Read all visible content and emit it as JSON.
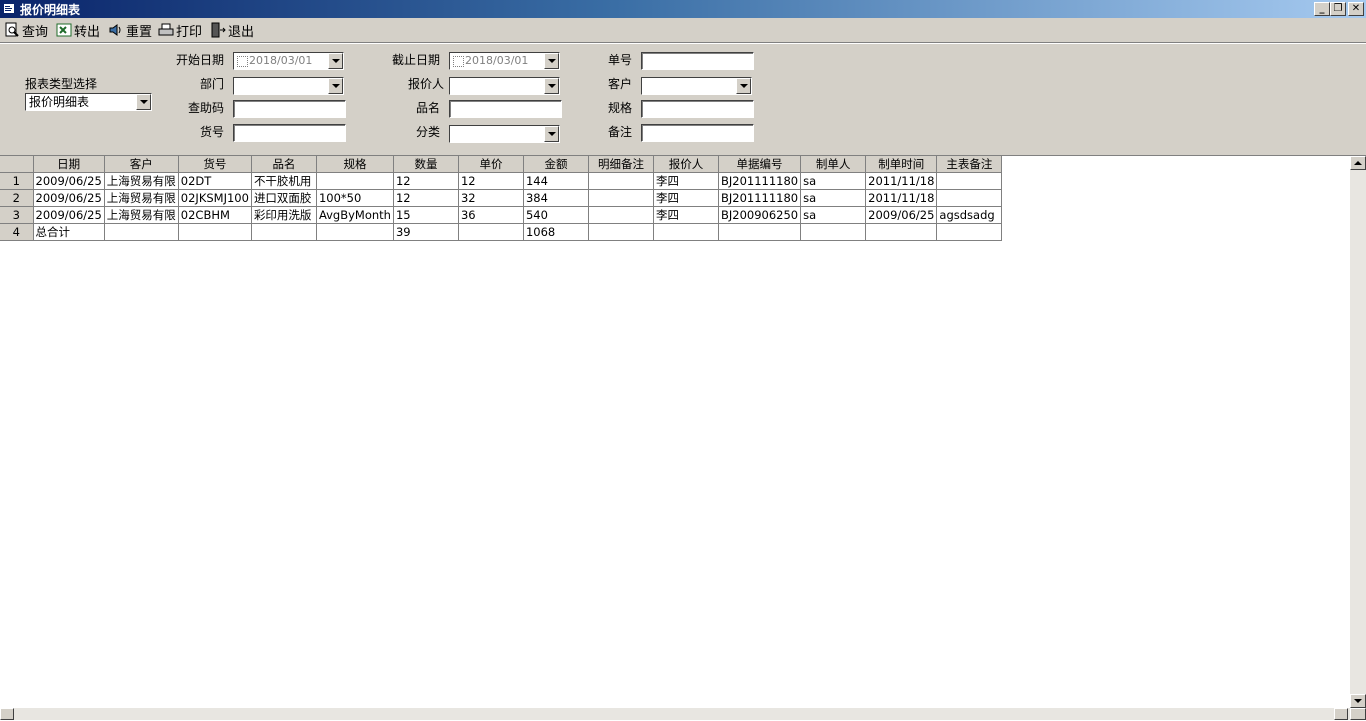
{
  "window": {
    "title": "报价明细表",
    "buttons": [
      "_",
      "❐",
      "✕"
    ]
  },
  "toolbar": {
    "query": "查询",
    "export": "转出",
    "reset": "重置",
    "print": "打印",
    "exit": "退出"
  },
  "filters": {
    "report_type_label": "报表类型选择",
    "report_type_value": "报价明细表",
    "start_date_label": "开始日期",
    "start_date_value": "2018/03/01",
    "end_date_label": "截止日期",
    "end_date_value": "2018/03/01",
    "doc_no_label": "单号",
    "dept_label": "部门",
    "quoter_label": "报价人",
    "customer_label": "客户",
    "helpcode_label": "查助码",
    "product_name_label": "品名",
    "spec_label": "规格",
    "item_no_label": "货号",
    "category_label": "分类",
    "remark_label": "备注"
  },
  "grid": {
    "columns": [
      "日期",
      "客户",
      "货号",
      "品名",
      "规格",
      "数量",
      "单价",
      "金额",
      "明细备注",
      "报价人",
      "单据编号",
      "制单人",
      "制单时间",
      "主表备注"
    ],
    "rows": [
      [
        "1",
        "2009/06/25",
        "上海贸易有限",
        "02DT",
        "不干胶机用",
        "",
        "12",
        "12",
        "144",
        "",
        "李四",
        "BJ201111180",
        "sa",
        "2011/11/18",
        ""
      ],
      [
        "2",
        "2009/06/25",
        "上海贸易有限",
        "02JKSMJ100",
        "进口双面胶",
        "100*50",
        "12",
        "32",
        "384",
        "",
        "李四",
        "BJ201111180",
        "sa",
        "2011/11/18",
        ""
      ],
      [
        "3",
        "2009/06/25",
        "上海贸易有限",
        "02CBHM",
        "彩印用洗版",
        "AvgByMonth",
        "15",
        "36",
        "540",
        "",
        "李四",
        "BJ200906250",
        "sa",
        "2009/06/25",
        "agsdsadg"
      ],
      [
        "4",
        "总合计",
        "",
        "",
        "",
        "",
        "39",
        "",
        "1068",
        "",
        "",
        "",
        "",
        "",
        ""
      ]
    ]
  }
}
